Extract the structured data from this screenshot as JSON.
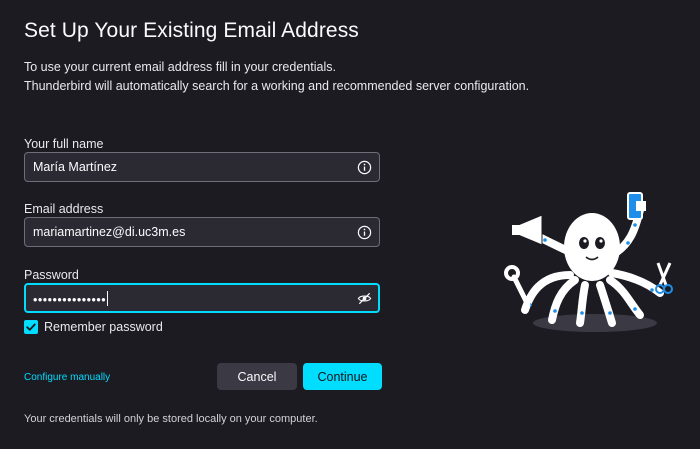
{
  "header": {
    "title": "Set Up Your Existing Email Address",
    "intro_line1": "To use your current email address fill in your credentials.",
    "intro_line2": "Thunderbird will automatically search for a working and recommended server configuration."
  },
  "form": {
    "full_name": {
      "label": "Your full name",
      "value": "María Martínez",
      "icon": "info-icon"
    },
    "email": {
      "label": "Email address",
      "value": "mariamartinez@di.uc3m.es",
      "icon": "info-icon"
    },
    "password": {
      "label": "Password",
      "value": "•••••••••••••••",
      "icon": "eye-slash-icon"
    },
    "remember": {
      "label": "Remember password",
      "checked": true
    }
  },
  "actions": {
    "configure_manually": "Configure manually",
    "cancel": "Cancel",
    "continue": "Continue"
  },
  "footer": {
    "note": "Your credentials will only be stored locally on your computer."
  },
  "colors": {
    "background": "#1c1b22",
    "accent": "#00ddff",
    "field_bg": "#2b2a33"
  }
}
